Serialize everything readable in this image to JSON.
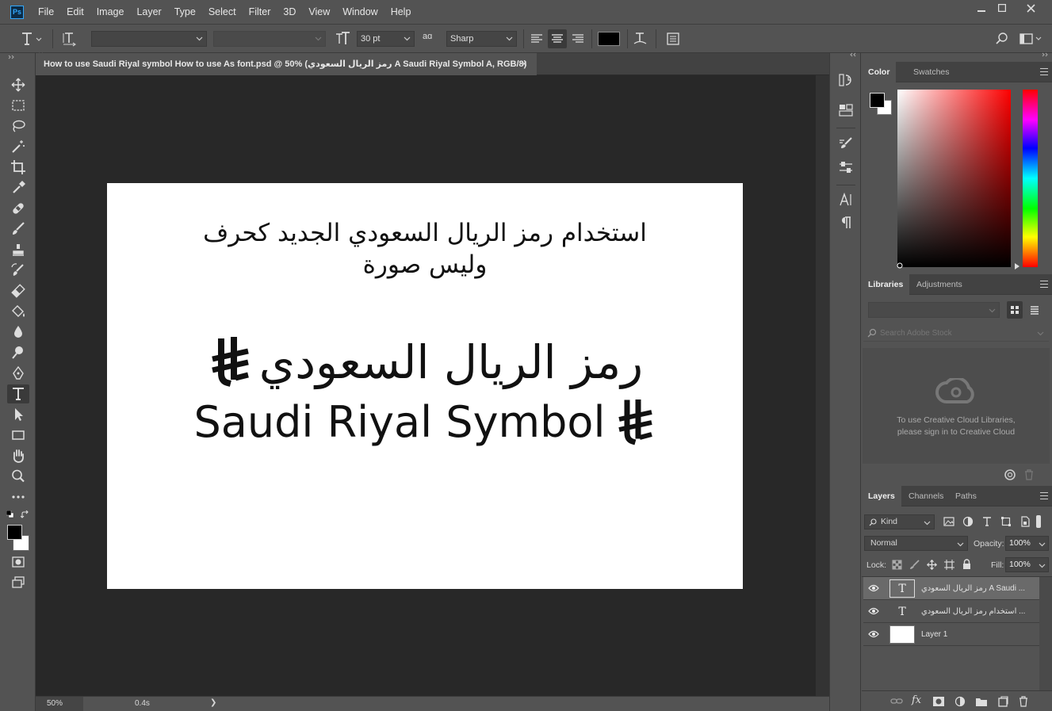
{
  "app": {
    "logo_text": "Ps"
  },
  "menu": [
    "File",
    "Edit",
    "Image",
    "Layer",
    "Type",
    "Select",
    "Filter",
    "3D",
    "View",
    "Window",
    "Help"
  ],
  "options": {
    "font_size": "30 pt",
    "aa_label": "aɑ",
    "antialias": "Sharp",
    "text_color": "#000000"
  },
  "document": {
    "tab_title": "How to use Saudi Riyal symbol How to use As font.psd @ 50% (رمز الريال السعودي A Saudi Riyal Symbol A, RGB/8)",
    "close_glyph": "×",
    "zoom": "50%",
    "timing": "0.4s",
    "status_arrow": "❯"
  },
  "artwork": {
    "headline_line1": "استخدام رمز الريال السعودي الجديد كحرف",
    "headline_line2": "وليس صورة",
    "arabic_name": "رمز الريال السعودي",
    "english_name": "Saudi Riyal Symbol"
  },
  "color_panel": {
    "tabs": [
      "Color",
      "Swatches"
    ],
    "foreground": "#000000",
    "background": "#ffffff"
  },
  "libraries_panel": {
    "tabs": [
      "Libraries",
      "Adjustments"
    ],
    "search_placeholder": "Search Adobe Stock",
    "message_line1": "To use Creative Cloud Libraries,",
    "message_line2": "please sign in to Creative Cloud"
  },
  "layers_panel": {
    "tabs": [
      "Layers",
      "Channels",
      "Paths"
    ],
    "filter_kind": "Kind",
    "blend_mode": "Normal",
    "opacity_label": "Opacity:",
    "opacity": "100%",
    "lock_label": "Lock:",
    "fill_label": "Fill:",
    "fill": "100%",
    "layers": [
      {
        "name": "رمز الريال السعودي A Saudi ...",
        "type": "text",
        "thumb_glyph": "T"
      },
      {
        "name": "استخدام رمز الريال السعودي ...",
        "type": "text",
        "thumb_glyph": "T"
      },
      {
        "name": "Layer 1",
        "type": "pixel",
        "thumb_glyph": ""
      }
    ],
    "footer_fx": "fx"
  }
}
